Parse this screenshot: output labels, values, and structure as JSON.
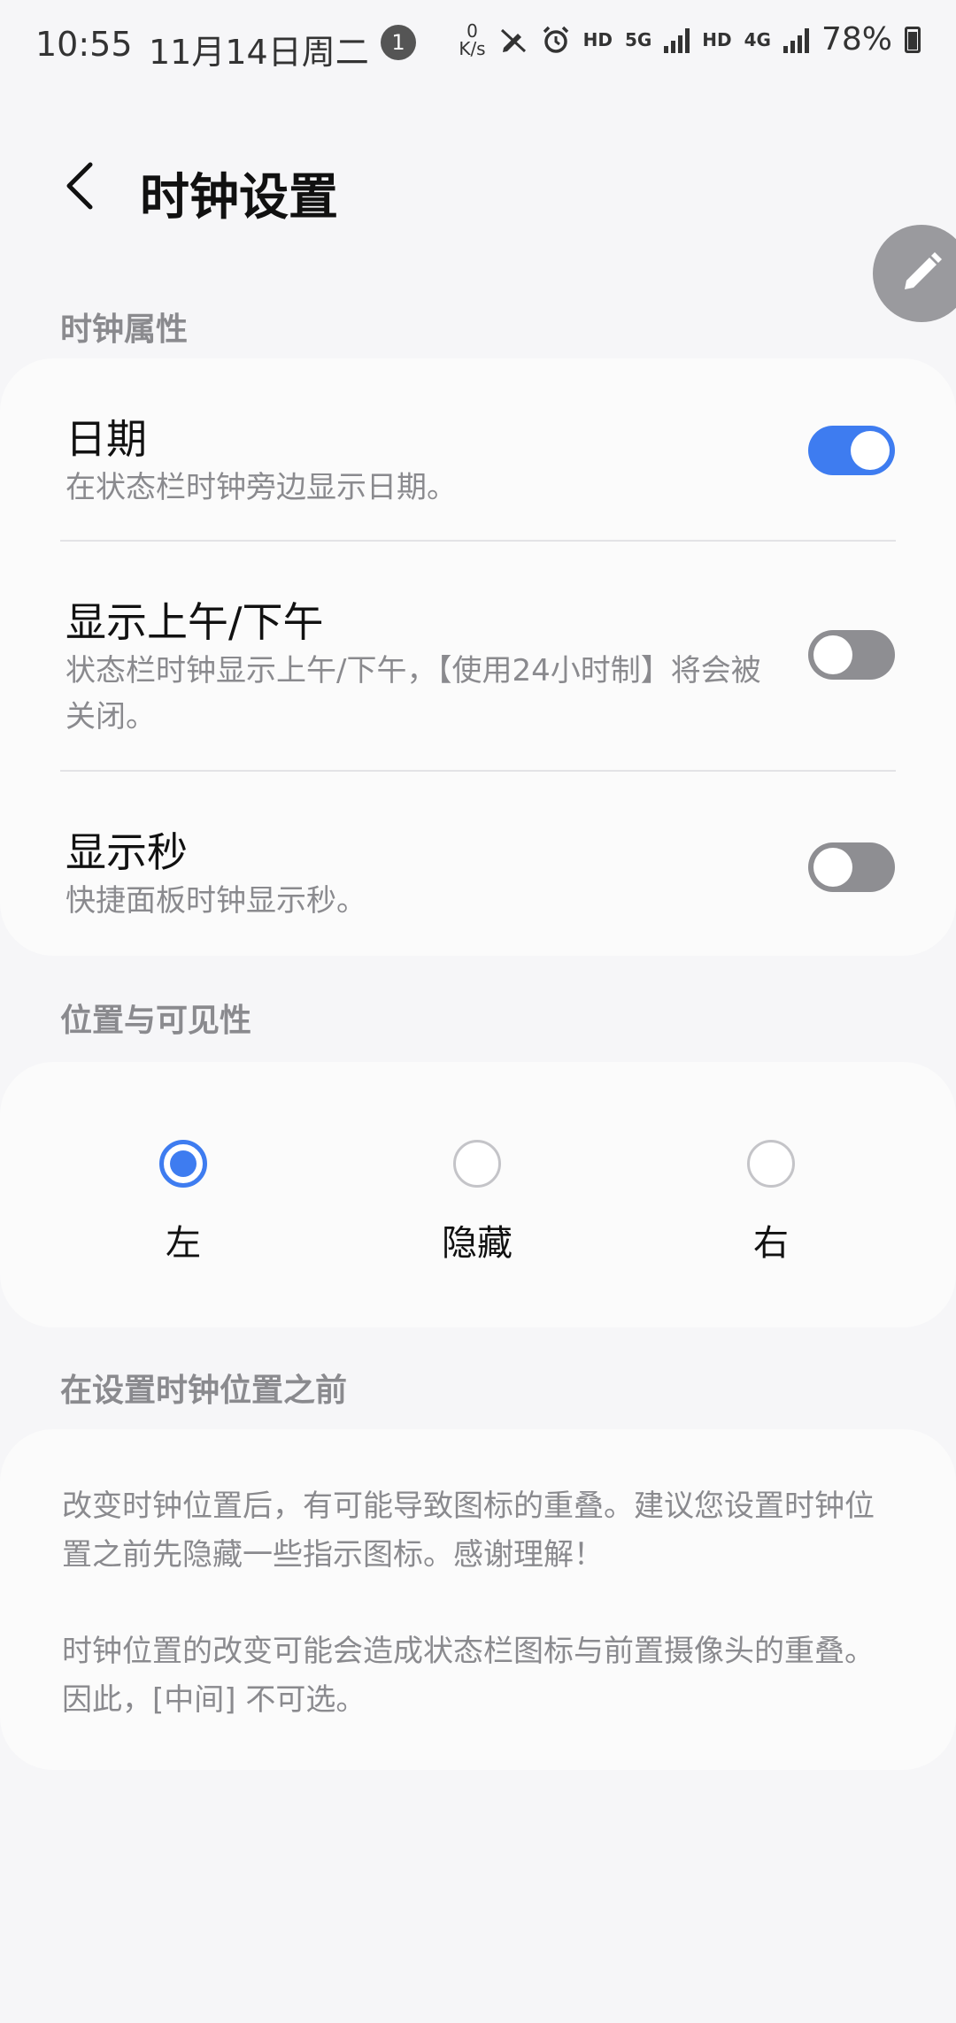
{
  "status_bar": {
    "time": "10:55",
    "date": "11月14日周二",
    "notification_count": "1",
    "net_speed_value": "0",
    "net_speed_unit": "K/s",
    "hd_label_1": "HD",
    "network_5g": "5G",
    "hd_label_2": "HD",
    "network_4g": "4G",
    "battery": "78%"
  },
  "header": {
    "title": "时钟设置"
  },
  "section_clock": {
    "header": "时钟属性",
    "items": [
      {
        "title": "日期",
        "subtitle": "在状态栏时钟旁边显示日期。",
        "enabled": true
      },
      {
        "title": "显示上午/下午",
        "subtitle": "状态栏时钟显示上午/下午，【使用24小时制】将会被关闭。",
        "enabled": false
      },
      {
        "title": "显示秒",
        "subtitle": "快捷面板时钟显示秒。",
        "enabled": false
      }
    ]
  },
  "section_position": {
    "header": "位置与可见性",
    "options": [
      {
        "label": "左",
        "selected": true
      },
      {
        "label": "隐藏",
        "selected": false
      },
      {
        "label": "右",
        "selected": false
      }
    ]
  },
  "section_note": {
    "header": "在设置时钟位置之前",
    "paragraphs": [
      "改变时钟位置后，有可能导致图标的重叠。建议您设置时钟位置之前先隐藏一些指示图标。感谢理解！",
      "时钟位置的改变可能会造成状态栏图标与前置摄像头的重叠。因此，[中间] 不可选。"
    ]
  },
  "colors": {
    "accent": "#3e7cf0",
    "toggle_off": "#8e8e92",
    "background": "#f6f6f8",
    "card": "#fbfbfb"
  }
}
